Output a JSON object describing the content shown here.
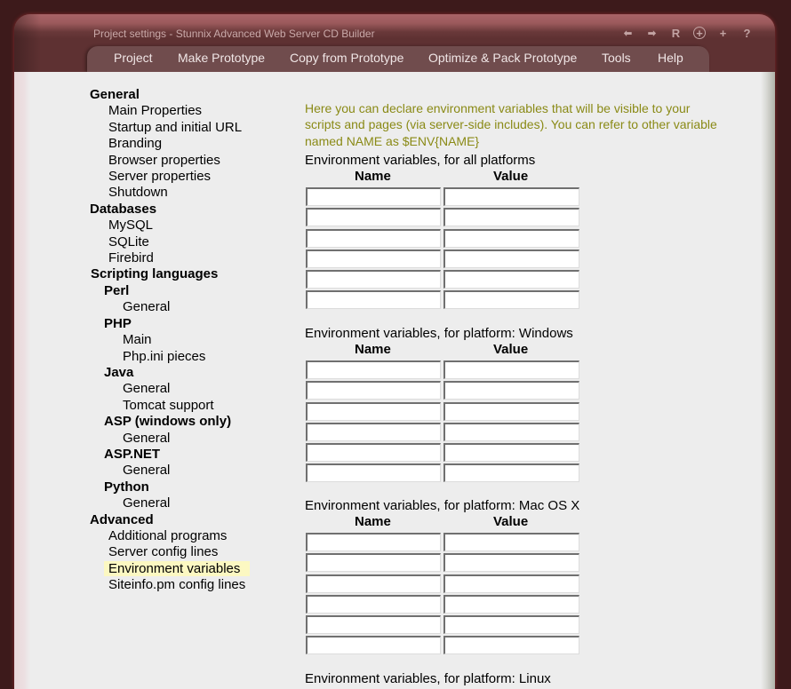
{
  "window": {
    "title": "Project settings - Stunnix Advanced Web Server CD Builder",
    "toolbar_icons": [
      {
        "name": "back-arrow-icon",
        "glyph": "⬅"
      },
      {
        "name": "forward-arrow-icon",
        "glyph": "➡"
      },
      {
        "name": "reload-icon",
        "glyph": "R"
      },
      {
        "name": "add-circle-icon",
        "glyph": "+"
      },
      {
        "name": "plus-icon",
        "glyph": "+"
      },
      {
        "name": "help-icon",
        "glyph": "?"
      }
    ]
  },
  "menu": [
    "Project",
    "Make Prototype",
    "Copy from Prototype",
    "Optimize & Pack Prototype",
    "Tools",
    "Help"
  ],
  "nav": [
    {
      "label": "General",
      "level": "h0"
    },
    {
      "label": "Main Properties",
      "level": "i0"
    },
    {
      "label": "Startup and initial URL",
      "level": "i0"
    },
    {
      "label": "Branding",
      "level": "i0"
    },
    {
      "label": "Browser properties",
      "level": "i0"
    },
    {
      "label": "Server properties",
      "level": "i0"
    },
    {
      "label": "Shutdown",
      "level": "i0"
    },
    {
      "label": "Databases",
      "level": "h0"
    },
    {
      "label": "MySQL",
      "level": "i0"
    },
    {
      "label": "SQLite",
      "level": "i0"
    },
    {
      "label": "Firebird",
      "level": "i0"
    },
    {
      "label": "Scripting languages",
      "level": "h0b"
    },
    {
      "label": "Perl",
      "level": "h1"
    },
    {
      "label": "General",
      "level": "i1"
    },
    {
      "label": "PHP",
      "level": "h1"
    },
    {
      "label": "Main",
      "level": "i1"
    },
    {
      "label": "Php.ini pieces",
      "level": "i1"
    },
    {
      "label": "Java",
      "level": "h1"
    },
    {
      "label": "General",
      "level": "i1"
    },
    {
      "label": "Tomcat support",
      "level": "i1"
    },
    {
      "label": "ASP (windows only)",
      "level": "h1"
    },
    {
      "label": "General",
      "level": "i1"
    },
    {
      "label": "ASP.NET",
      "level": "h1"
    },
    {
      "label": "General",
      "level": "i1"
    },
    {
      "label": "Python",
      "level": "h1"
    },
    {
      "label": "General",
      "level": "i1"
    },
    {
      "label": "Advanced",
      "level": "h0"
    },
    {
      "label": "Additional programs",
      "level": "i0"
    },
    {
      "label": "Server config lines",
      "level": "i0"
    },
    {
      "label": "Environment variables",
      "level": "i0",
      "selected": true
    },
    {
      "label": "Siteinfo.pm config lines",
      "level": "i0"
    }
  ],
  "main": {
    "intro": "Here you can declare environment variables that will be visible to your scripts and pages (via server-side includes). You can refer to other variable named NAME as $ENV{NAME}",
    "col_name": "Name",
    "col_value": "Value",
    "intro_color": "#8a8a16",
    "selected_highlight": "#fcf8c2",
    "sections": [
      {
        "title": "Environment variables, for all platforms",
        "rows": [
          [
            "",
            ""
          ],
          [
            "",
            ""
          ],
          [
            "",
            ""
          ],
          [
            "",
            ""
          ],
          [
            "",
            ""
          ],
          [
            "",
            ""
          ]
        ]
      },
      {
        "title": "Environment variables, for platform: Windows",
        "rows": [
          [
            "",
            ""
          ],
          [
            "",
            ""
          ],
          [
            "",
            ""
          ],
          [
            "",
            ""
          ],
          [
            "",
            ""
          ],
          [
            "",
            ""
          ]
        ]
      },
      {
        "title": "Environment variables, for platform: Mac OS X",
        "rows": [
          [
            "",
            ""
          ],
          [
            "",
            ""
          ],
          [
            "",
            ""
          ],
          [
            "",
            ""
          ],
          [
            "",
            ""
          ],
          [
            "",
            ""
          ]
        ]
      },
      {
        "title": "Environment variables, for platform: Linux",
        "rows": []
      }
    ]
  }
}
